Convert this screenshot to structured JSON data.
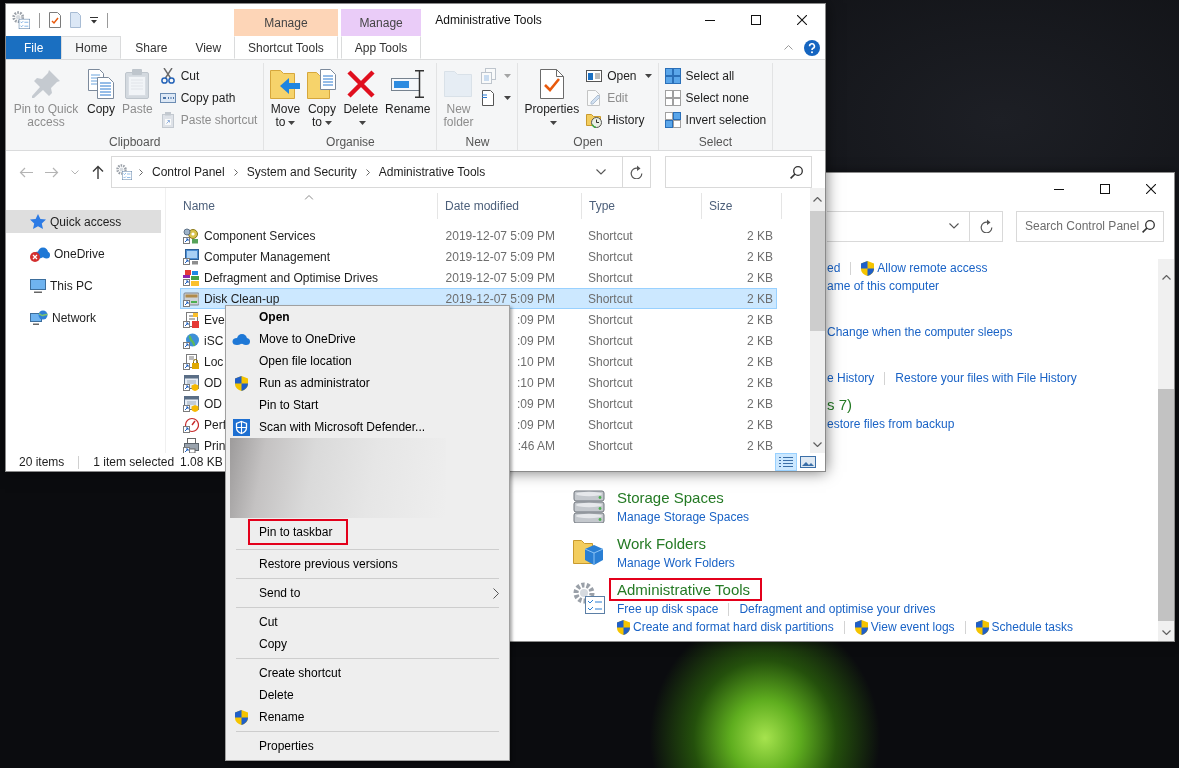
{
  "explorer": {
    "title": "Administrative Tools",
    "ribbon_tabs": [
      {
        "label": "File",
        "kind": "file",
        "selected": false
      },
      {
        "label": "Home",
        "kind": "main",
        "selected": true
      },
      {
        "label": "Share",
        "kind": "main",
        "selected": false
      },
      {
        "label": "View",
        "kind": "main",
        "selected": false
      },
      {
        "label": "Shortcut Tools",
        "kind": "context",
        "header": "Manage",
        "color": "#fdd5b7",
        "selected": false
      },
      {
        "label": "App Tools",
        "kind": "context",
        "header": "Manage",
        "color": "#eaccf8",
        "selected": false
      }
    ],
    "ribbon_groups": [
      {
        "label": "Clipboard",
        "buttons": [
          {
            "label": "Pin to Quick access",
            "kind": "wide",
            "disabled": true,
            "dropdown": false
          },
          {
            "label": "Copy",
            "kind": "large",
            "disabled": false,
            "dropdown": false
          },
          {
            "label": "Paste",
            "kind": "large",
            "disabled": true,
            "dropdown": false
          },
          {
            "label": "Cut",
            "kind": "small",
            "disabled": false,
            "dropdown": false
          },
          {
            "label": "Copy path",
            "kind": "small",
            "disabled": false,
            "dropdown": false
          },
          {
            "label": "Paste shortcut",
            "kind": "small",
            "disabled": true,
            "dropdown": false
          }
        ]
      },
      {
        "label": "Organise",
        "buttons": [
          {
            "label": "Move to",
            "kind": "large",
            "disabled": false,
            "dropdown": true
          },
          {
            "label": "Copy to",
            "kind": "large",
            "disabled": false,
            "dropdown": true
          },
          {
            "label": "Delete",
            "kind": "large",
            "disabled": false,
            "dropdown": true
          },
          {
            "label": "Rename",
            "kind": "large",
            "disabled": false,
            "dropdown": false
          }
        ]
      },
      {
        "label": "New",
        "buttons": [
          {
            "label": "New folder",
            "kind": "large",
            "disabled": true,
            "dropdown": false
          },
          {
            "kind": "icon",
            "disabled": true,
            "dropdown": true
          },
          {
            "kind": "icon",
            "disabled": false,
            "dropdown": true
          }
        ]
      },
      {
        "label": "Open",
        "buttons": [
          {
            "label": "Properties",
            "kind": "large",
            "disabled": false,
            "dropdown": true
          },
          {
            "label": "Open",
            "kind": "small",
            "disabled": false,
            "dropdown": true
          },
          {
            "label": "Edit",
            "kind": "small",
            "disabled": true,
            "dropdown": false
          },
          {
            "label": "History",
            "kind": "small",
            "disabled": false,
            "dropdown": false
          }
        ]
      },
      {
        "label": "Select",
        "buttons": [
          {
            "label": "Select all",
            "kind": "small",
            "disabled": false,
            "dropdown": false
          },
          {
            "label": "Select none",
            "kind": "small",
            "disabled": false,
            "dropdown": false
          },
          {
            "label": "Invert selection",
            "kind": "small",
            "disabled": false,
            "dropdown": false
          }
        ]
      }
    ],
    "nav_buttons": [
      {
        "kind": "back",
        "disabled": true
      },
      {
        "kind": "forward",
        "disabled": true
      },
      {
        "kind": "recent",
        "disabled": true
      },
      {
        "kind": "up",
        "disabled": false
      }
    ],
    "breadcrumbs": [
      "Control Panel",
      "System and Security",
      "Administrative Tools"
    ],
    "nav_pane": [
      {
        "label": "Quick access",
        "selected": true
      },
      {
        "label": "OneDrive",
        "selected": false
      },
      {
        "label": "This PC",
        "selected": false
      },
      {
        "label": "Network",
        "selected": false
      }
    ],
    "columns": [
      {
        "label": "Name",
        "sorted": true
      },
      {
        "label": "Date modified",
        "sorted": false
      },
      {
        "label": "Type",
        "sorted": false
      },
      {
        "label": "Size",
        "sorted": false
      }
    ],
    "rows": [
      {
        "name": "Component Services",
        "date": "2019-12-07 5:09 PM",
        "type": "Shortcut",
        "size": "2 KB",
        "selected": false
      },
      {
        "name": "Computer Management",
        "date": "2019-12-07 5:09 PM",
        "type": "Shortcut",
        "size": "2 KB",
        "selected": false
      },
      {
        "name": "Defragment and Optimise Drives",
        "date": "2019-12-07 5:09 PM",
        "type": "Shortcut",
        "size": "2 KB",
        "selected": false
      },
      {
        "name": "Disk Clean-up",
        "date": "2019-12-07 5:09 PM",
        "type": "Shortcut",
        "size": "2 KB",
        "selected": true
      },
      {
        "name": "Eve",
        "date": ":09 PM",
        "type": "Shortcut",
        "size": "2 KB",
        "selected": false
      },
      {
        "name": "iSC",
        "date": ":09 PM",
        "type": "Shortcut",
        "size": "2 KB",
        "selected": false
      },
      {
        "name": "Loc",
        "date": ":10 PM",
        "type": "Shortcut",
        "size": "2 KB",
        "selected": false
      },
      {
        "name": "OD",
        "date": ":10 PM",
        "type": "Shortcut",
        "size": "2 KB",
        "selected": false
      },
      {
        "name": "OD",
        "date": ":09 PM",
        "type": "Shortcut",
        "size": "2 KB",
        "selected": false
      },
      {
        "name": "Perf",
        "date": ":09 PM",
        "type": "Shortcut",
        "size": "2 KB",
        "selected": false
      },
      {
        "name": "Prin",
        "date": ":46 AM",
        "type": "Shortcut",
        "size": "2 KB",
        "selected": false
      }
    ],
    "status_bar": {
      "items": "20 items",
      "selection": "1 item selected",
      "size": "1.08 KB"
    },
    "view_buttons": [
      {
        "kind": "details",
        "selected": true
      },
      {
        "kind": "large_icons",
        "selected": false
      }
    ]
  },
  "control_panel": {
    "search": {
      "placeholder": "Search Control Panel"
    },
    "sections": [
      {
        "kind": "partial",
        "links": [
          [
            {
              "text": "ed",
              "admin": false
            },
            {
              "text": "Allow remote access",
              "admin": true
            }
          ],
          [
            {
              "text": "ame of this computer",
              "admin": false
            }
          ]
        ]
      },
      {
        "kind": "partial",
        "links": [
          [
            {
              "text": "Change when the computer sleeps",
              "admin": false
            }
          ]
        ]
      },
      {
        "kind": "partial",
        "links": [
          [
            {
              "text": "e History",
              "admin": false
            },
            {
              "text": "Restore your files with File History",
              "admin": false
            }
          ]
        ]
      },
      {
        "kind": "partial",
        "title": "s 7)",
        "highlighted": false,
        "links": [
          [
            {
              "text": "estore files from backup",
              "admin": false
            }
          ]
        ]
      },
      {
        "kind": "full",
        "title": "Storage Spaces",
        "highlighted": false,
        "links": [
          [
            {
              "text": "Manage Storage Spaces",
              "admin": false
            }
          ]
        ]
      },
      {
        "kind": "full",
        "title": "Work Folders",
        "highlighted": false,
        "links": [
          [
            {
              "text": "Manage Work Folders",
              "admin": false
            }
          ]
        ]
      },
      {
        "kind": "full",
        "title": "Administrative Tools",
        "highlighted": true,
        "links": [
          [
            {
              "text": "Free up disk space",
              "admin": false
            },
            {
              "text": "Defragment and optimise your drives",
              "admin": false
            }
          ],
          [
            {
              "text": "Create and format hard disk partitions",
              "admin": true
            },
            {
              "text": "View event logs",
              "admin": true
            },
            {
              "text": "Schedule tasks",
              "admin": true
            }
          ]
        ]
      }
    ]
  },
  "context_menu": {
    "items": [
      {
        "kind": "item",
        "label": "Open",
        "default": true,
        "admin": false,
        "submenu": false,
        "highlighted": false
      },
      {
        "kind": "item",
        "label": "Move to OneDrive",
        "default": false,
        "admin": false,
        "submenu": false,
        "highlighted": false
      },
      {
        "kind": "item",
        "label": "Open file location",
        "default": false,
        "admin": false,
        "submenu": false,
        "highlighted": false
      },
      {
        "kind": "item",
        "label": "Run as administrator",
        "default": false,
        "admin": true,
        "submenu": false,
        "highlighted": false
      },
      {
        "kind": "item",
        "label": "Pin to Start",
        "default": false,
        "admin": false,
        "submenu": false,
        "highlighted": false
      },
      {
        "kind": "item",
        "label": "Scan with Microsoft Defender...",
        "default": false,
        "admin": false,
        "submenu": false,
        "highlighted": false
      },
      {
        "kind": "blurred"
      },
      {
        "kind": "item",
        "label": "Pin to taskbar",
        "default": false,
        "admin": false,
        "submenu": false,
        "highlighted": true
      },
      {
        "kind": "separator"
      },
      {
        "kind": "item",
        "label": "Restore previous versions",
        "default": false,
        "admin": false,
        "submenu": false,
        "highlighted": false
      },
      {
        "kind": "separator"
      },
      {
        "kind": "item",
        "label": "Send to",
        "default": false,
        "admin": false,
        "submenu": true,
        "highlighted": false
      },
      {
        "kind": "separator"
      },
      {
        "kind": "item",
        "label": "Cut",
        "default": false,
        "admin": false,
        "submenu": false,
        "highlighted": false
      },
      {
        "kind": "item",
        "label": "Copy",
        "default": false,
        "admin": false,
        "submenu": false,
        "highlighted": false
      },
      {
        "kind": "separator"
      },
      {
        "kind": "item",
        "label": "Create shortcut",
        "default": false,
        "admin": false,
        "submenu": false,
        "highlighted": false
      },
      {
        "kind": "item",
        "label": "Delete",
        "default": false,
        "admin": false,
        "submenu": false,
        "highlighted": false
      },
      {
        "kind": "item",
        "label": "Rename",
        "default": false,
        "admin": true,
        "submenu": false,
        "highlighted": false
      },
      {
        "kind": "separator"
      },
      {
        "kind": "item",
        "label": "Properties",
        "default": false,
        "admin": false,
        "submenu": false,
        "highlighted": false
      }
    ]
  }
}
